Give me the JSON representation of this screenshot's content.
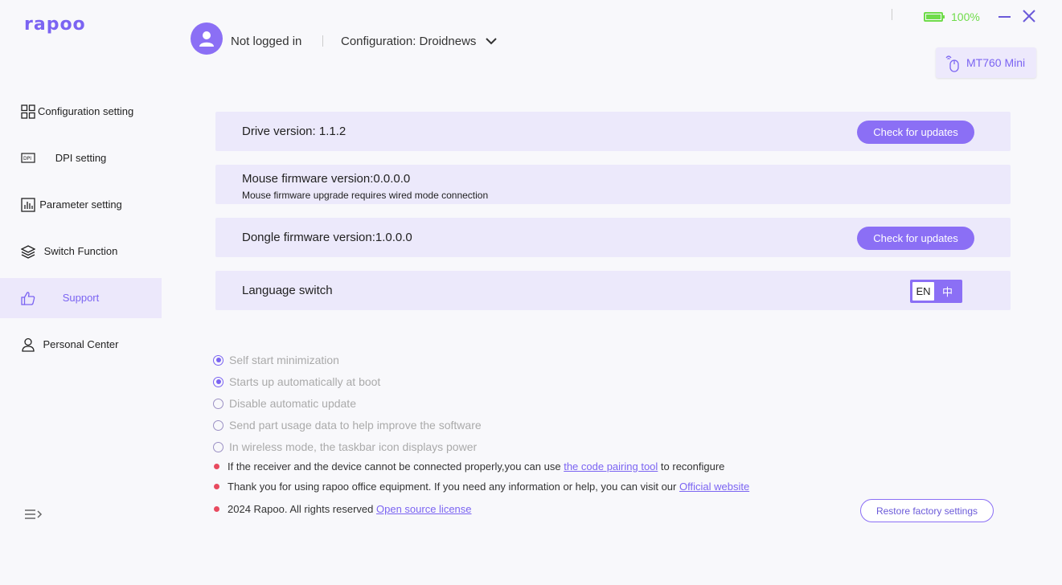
{
  "app": {
    "logo": "rapoo",
    "accent_color": "#8b6ff5",
    "battery_color": "#6fdc4a",
    "warning_dot_color": "#e84a5f"
  },
  "header": {
    "user_status": "Not logged in",
    "configuration_label": "Configuration: Droidnews",
    "battery_percent": "100%",
    "device_name": "MT760 Mini"
  },
  "sidebar": {
    "items": [
      {
        "label": "Configuration setting",
        "icon": "grid-icon"
      },
      {
        "label": "DPI setting",
        "icon": "dpi-icon"
      },
      {
        "label": "Parameter setting",
        "icon": "bar-chart-icon"
      },
      {
        "label": "Switch Function",
        "icon": "layers-icon"
      },
      {
        "label": "Support",
        "icon": "thumbs-up-icon",
        "active": true
      },
      {
        "label": "Personal Center",
        "icon": "person-icon"
      }
    ]
  },
  "main": {
    "drive": {
      "title": "Drive version: 1.1.2",
      "button": "Check for updates"
    },
    "mouse_fw": {
      "title": "Mouse firmware version:0.0.0.0",
      "subtitle": "Mouse firmware upgrade requires wired mode connection"
    },
    "dongle_fw": {
      "title": "Dongle firmware version:1.0.0.0",
      "button": "Check for updates"
    },
    "language": {
      "title": "Language switch",
      "options": [
        "EN",
        "中"
      ],
      "selected": "EN"
    },
    "options": [
      {
        "label": "Self start minimization",
        "checked": true
      },
      {
        "label": "Starts up automatically at boot",
        "checked": true
      },
      {
        "label": "Disable automatic update",
        "checked": false
      },
      {
        "label": "Send part usage data to help improve the software",
        "checked": false
      },
      {
        "label": "In wireless mode, the taskbar icon displays power",
        "checked": false
      }
    ],
    "notes": [
      {
        "text_before": "If the receiver and the device cannot be connected properly,you can use ",
        "link": "the code pairing tool",
        "text_after": " to reconfigure"
      },
      {
        "text_before": "Thank you for using rapoo office equipment. If you need any information or help, you can visit our ",
        "link": "Official website",
        "text_after": ""
      },
      {
        "text_before": "2024 Rapoo. All rights reserved ",
        "link": "Open source license",
        "text_after": ""
      }
    ],
    "restore_button": "Restore factory settings"
  }
}
